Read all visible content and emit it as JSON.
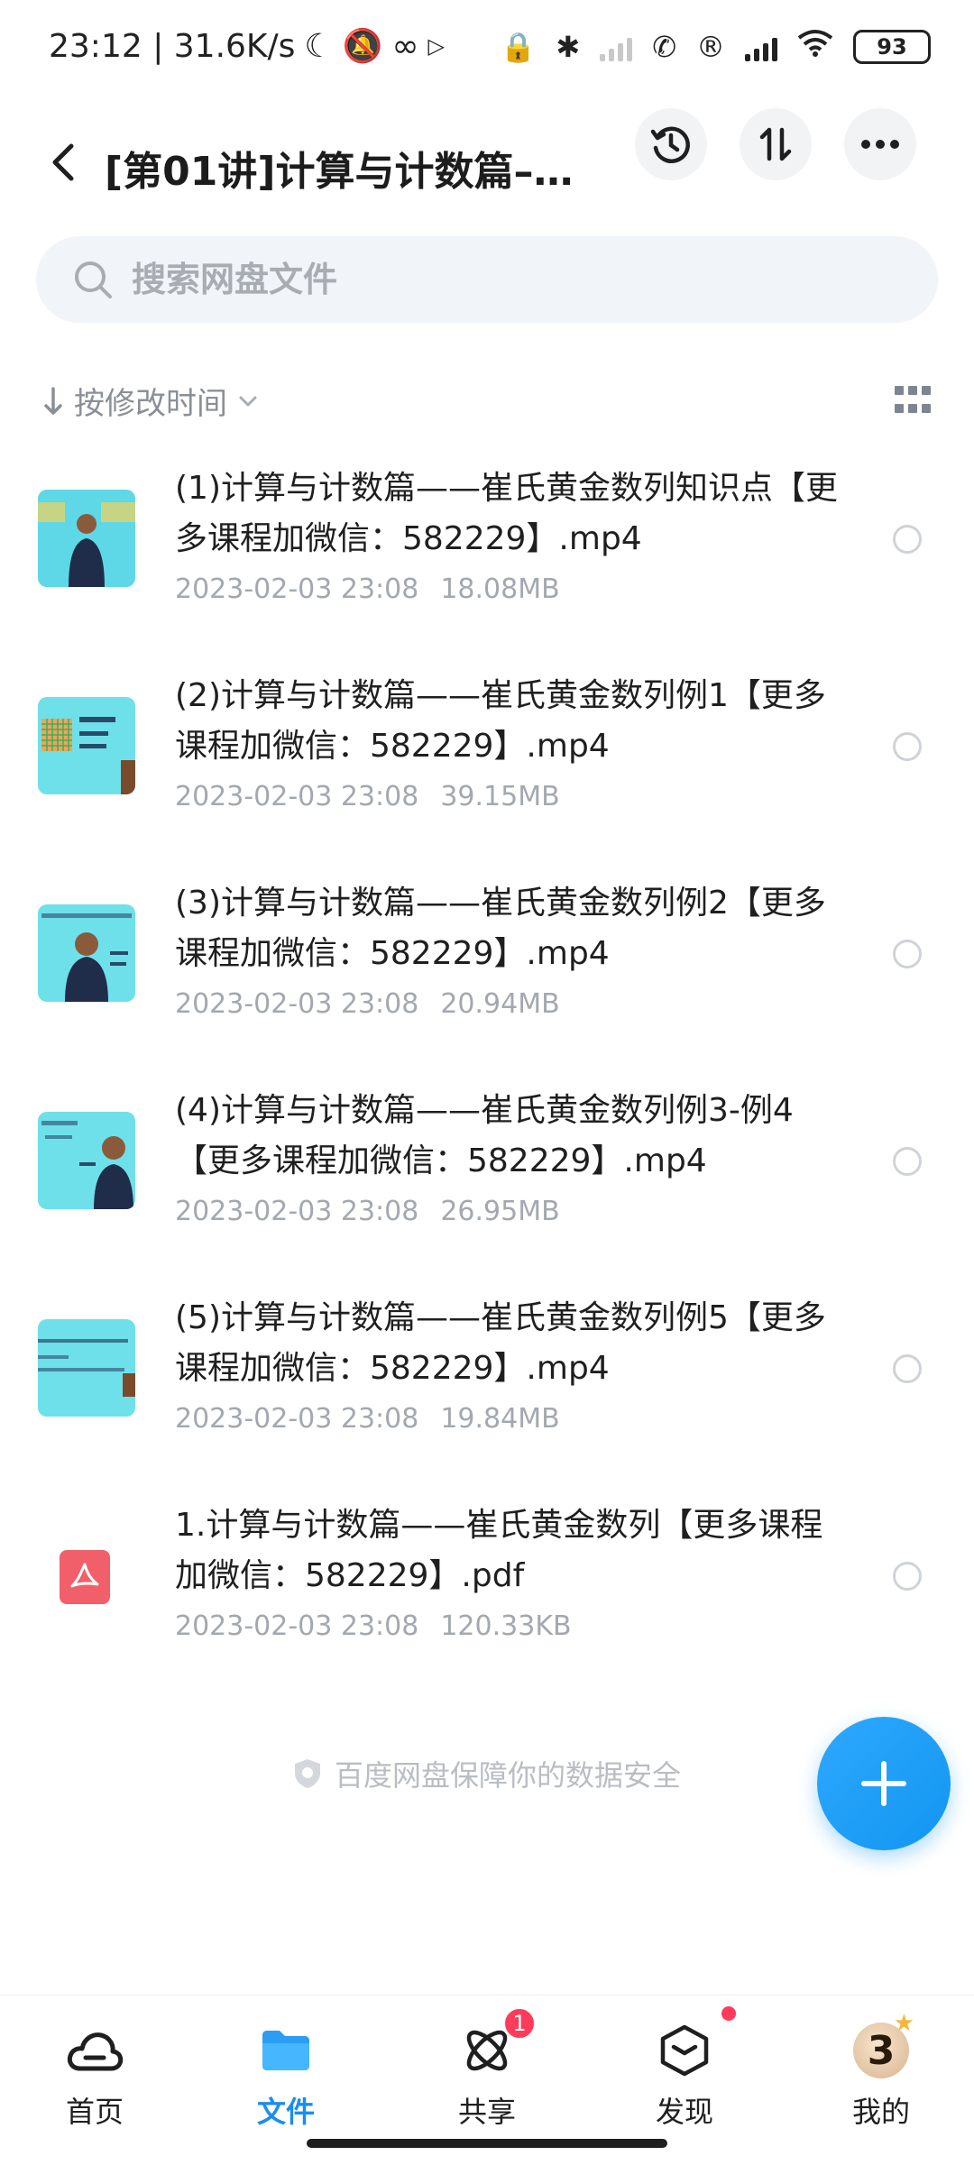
{
  "status_bar": {
    "time_speed": "23:12 | 31.6K/s",
    "battery": "93"
  },
  "header": {
    "title": "[第01讲]计算与计数篇–..."
  },
  "search": {
    "placeholder": "搜索网盘文件"
  },
  "sort": {
    "label": "按修改时间"
  },
  "files": [
    {
      "name": "(1)计算与计数篇——崔氏黄金数列知识点【更多课程加微信：582229】.mp4",
      "date": "2023-02-03  23:08",
      "size": "18.08MB",
      "type": "video"
    },
    {
      "name": "(2)计算与计数篇——崔氏黄金数列例1【更多课程加微信：582229】.mp4",
      "date": "2023-02-03  23:08",
      "size": "39.15MB",
      "type": "video"
    },
    {
      "name": "(3)计算与计数篇——崔氏黄金数列例2【更多课程加微信：582229】.mp4",
      "date": "2023-02-03  23:08",
      "size": "20.94MB",
      "type": "video"
    },
    {
      "name": "(4)计算与计数篇——崔氏黄金数列例3-例4【更多课程加微信：582229】.mp4",
      "date": "2023-02-03  23:08",
      "size": "26.95MB",
      "type": "video"
    },
    {
      "name": "(5)计算与计数篇——崔氏黄金数列例5【更多课程加微信：582229】.mp4",
      "date": "2023-02-03  23:08",
      "size": "19.84MB",
      "type": "video"
    },
    {
      "name": "1.计算与计数篇——崔氏黄金数列【更多课程加微信：582229】.pdf",
      "date": "2023-02-03  23:08",
      "size": "120.33KB",
      "type": "pdf"
    }
  ],
  "security_note": "百度网盘保障你的数据安全",
  "bottom_nav": {
    "items": [
      {
        "label": "首页",
        "active": false
      },
      {
        "label": "文件",
        "active": true
      },
      {
        "label": "共享",
        "active": false,
        "badge": "1"
      },
      {
        "label": "发现",
        "active": false
      },
      {
        "label": "我的",
        "active": false
      }
    ],
    "avatar_text": "3"
  },
  "colors": {
    "accent": "#1a8df0",
    "badge": "#ff3b5c",
    "pdf": "#f1606a"
  }
}
